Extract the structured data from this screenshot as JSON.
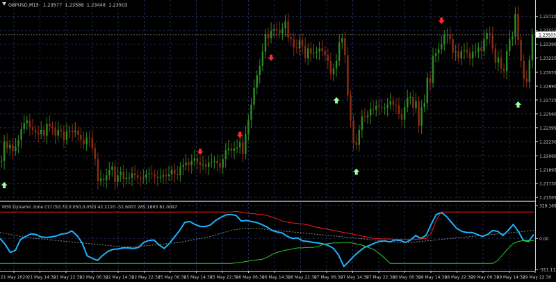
{
  "main_chart": {
    "symbol": "GBPUSD",
    "timeframe": "M15",
    "ohlc": [
      "1.23577",
      "1.23588",
      "1.23448",
      "1.23503"
    ],
    "current_price": "1.23503",
    "price_scale": [
      "1.23720",
      "1.23555",
      "1.23390",
      "1.23225",
      "1.23055",
      "1.22890",
      "1.22725",
      "1.22560",
      "1.22395",
      "1.22230",
      "1.22060",
      "1.21895",
      "1.21730",
      "1.21565"
    ]
  },
  "indicator": {
    "label": "M30 Dynamic zone CCI (50,70,0.050,0.050) 42.2120 -52.6007 265.1863 81.0097",
    "scale": [
      "329.1699",
      "0.00",
      "-311.1133"
    ]
  },
  "time_axis": [
    "21 May 2020",
    "21 May 14:30",
    "21 May 22:30",
    "22 May 06:30",
    "22 May 14:30",
    "22 May 22:30",
    "25 May 06:30",
    "25 May 14:30",
    "25 May 22:30",
    "26 May 06:30",
    "26 May 14:30",
    "26 May 22:30",
    "27 May 06:30",
    "27 May 14:30",
    "27 May 22:30",
    "28 May 06:30",
    "28 May 14:30",
    "28 May 22:30",
    "29 May 06:30",
    "29 May 14:30",
    "29 May 22:30"
  ],
  "colors": {
    "background": "#000000",
    "grid": "#1f2a52",
    "axis": "#c8c8c8",
    "bull_candle": "#2e8b22",
    "bear_candle": "#8b2d12",
    "buy_arrow": "#9fff9f",
    "sell_arrow": "#ff2a2a",
    "cci_line": "#1eb4ff",
    "upper_zone": "#ff1a1a",
    "lower_zone": "#2ecc2e",
    "signal_line": "#8a8a8a"
  },
  "signals": {
    "sell": [
      {
        "x": 70,
        "price": 1.2203
      },
      {
        "x": 84,
        "price": 1.2223
      },
      {
        "x": 95,
        "price": 1.2315
      },
      {
        "x": 155,
        "price": 1.2359
      }
    ],
    "buy": [
      {
        "x": 1,
        "price": 1.2179
      },
      {
        "x": 118,
        "price": 1.228
      },
      {
        "x": 125,
        "price": 1.2195
      },
      {
        "x": 182,
        "price": 1.2275
      }
    ]
  },
  "chart_data": [
    {
      "type": "candlestick",
      "title": "GBPUSD,M15",
      "close": [
        1.22,
        1.2223,
        1.2215,
        1.2219,
        1.2212,
        1.2217,
        1.2225,
        1.2238,
        1.2245,
        1.2248,
        1.224,
        1.2237,
        1.2234,
        1.2232,
        1.2237,
        1.223,
        1.2244,
        1.2241,
        1.2239,
        1.223,
        1.2237,
        1.2235,
        1.2225,
        1.2235,
        1.2236,
        1.2234,
        1.2236,
        1.2231,
        1.2225,
        1.222,
        1.2228,
        1.2227,
        1.2215,
        1.2202,
        1.2176,
        1.2179,
        1.2177,
        1.2183,
        1.2189,
        1.2193,
        1.2175,
        1.2183,
        1.2187,
        1.2178,
        1.218,
        1.218,
        1.2185,
        1.2183,
        1.218,
        1.2179,
        1.218,
        1.2184,
        1.2185,
        1.2184,
        1.2181,
        1.218,
        1.2181,
        1.2183,
        1.2182,
        1.2184,
        1.2189,
        1.2184,
        1.2183,
        1.2193,
        1.2195,
        1.2198,
        1.2195,
        1.22,
        1.2203,
        1.2198,
        1.2195,
        1.2196,
        1.2193,
        1.2198,
        1.2199,
        1.22,
        1.2197,
        1.2192,
        1.2202,
        1.2213,
        1.2215,
        1.2212,
        1.2215,
        1.2216,
        1.2222,
        1.2208,
        1.2232,
        1.2249,
        1.2267,
        1.2287,
        1.2302,
        1.2313,
        1.233,
        1.2351,
        1.2346,
        1.2355,
        1.2357,
        1.2356,
        1.2352,
        1.2358,
        1.2366,
        1.2347,
        1.2345,
        1.2335,
        1.2334,
        1.2344,
        1.2337,
        1.2322,
        1.2334,
        1.2328,
        1.2329,
        1.233,
        1.2334,
        1.2331,
        1.2326,
        1.2319,
        1.2303,
        1.231,
        1.2319,
        1.2341,
        1.2346,
        1.2326,
        1.2278,
        1.2248,
        1.2222,
        1.2219,
        1.2237,
        1.2253,
        1.2252,
        1.2254,
        1.2262,
        1.2261,
        1.2266,
        1.2264,
        1.2263,
        1.2263,
        1.2267,
        1.2271,
        1.2267,
        1.2266,
        1.2256,
        1.2249,
        1.2264,
        1.2275,
        1.2276,
        1.2263,
        1.2271,
        1.2242,
        1.2264,
        1.2269,
        1.2299,
        1.2293,
        1.2325,
        1.2328,
        1.2333,
        1.2339,
        1.235,
        1.235,
        1.2345,
        1.2329,
        1.233,
        1.2322,
        1.2331,
        1.2332,
        1.2329,
        1.2322,
        1.233,
        1.233,
        1.2335,
        1.2331,
        1.2345,
        1.2352,
        1.235,
        1.2334,
        1.2317,
        1.2323,
        1.231,
        1.2307,
        1.2331,
        1.2345,
        1.2348,
        1.2375,
        1.2344,
        1.2319,
        1.2298,
        1.2294,
        1.232,
        1.235
      ],
      "ylim": [
        1.2155,
        1.238
      ]
    },
    {
      "type": "line",
      "title": "M30 Dynamic zone CCI (50,70,0.050,0.050)",
      "ylim": [
        -311.1133,
        329.1699
      ],
      "series": [
        {
          "values": [
            0,
            -60,
            -140,
            -120,
            -10,
            20,
            45,
            40,
            15,
            10,
            15,
            25,
            45,
            50,
            75,
            30,
            -45,
            -175,
            -200,
            -220,
            -170,
            -130,
            -110,
            -105,
            -95,
            -95,
            -100,
            -90,
            -40,
            -20,
            -15,
            -65,
            -100,
            -50,
            15,
            80,
            160,
            170,
            140,
            120,
            120,
            135,
            180,
            210,
            235,
            240,
            230,
            175,
            180,
            170,
            160,
            140,
            115,
            80,
            65,
            55,
            20,
            0,
            5,
            -25,
            -30,
            -40,
            -45,
            -55,
            -70,
            -100,
            -170,
            -280,
            -230,
            -175,
            -130,
            -90,
            -70,
            -45,
            -30,
            -25,
            -35,
            -15,
            -20,
            -40,
            -15,
            30,
            0,
            30,
            140,
            240,
            260,
            220,
            160,
            100,
            70,
            60,
            60,
            40,
            20,
            40,
            80,
            70,
            30,
            80,
            140,
            70,
            -20,
            -30,
            40
          ]
        },
        {
          "values": [
            265,
            265,
            265,
            265,
            265,
            265,
            265,
            265,
            265,
            265,
            265,
            265,
            265,
            265,
            265,
            265,
            265,
            265,
            265,
            265,
            265,
            265,
            265,
            265,
            265,
            265,
            265,
            265,
            265,
            265,
            265,
            265,
            265,
            265,
            265,
            265,
            265,
            265,
            265,
            265,
            265,
            265,
            265,
            265,
            265,
            265,
            270,
            265,
            255,
            250,
            245,
            240,
            230,
            215,
            195,
            175,
            165,
            155,
            150,
            145,
            135,
            120,
            110,
            100,
            90,
            80,
            70,
            60,
            50,
            40,
            30,
            20,
            10,
            0,
            -5,
            -5,
            -5,
            -10,
            -10,
            -10,
            -10,
            -10,
            -5,
            0,
            50,
            180,
            265,
            265,
            265,
            265,
            265,
            265,
            265,
            265,
            265,
            265,
            265,
            265,
            265,
            265,
            265,
            265,
            265,
            265,
            265
          ]
        },
        {
          "values": [
            -250,
            -250,
            -250,
            -250,
            -250,
            -250,
            -250,
            -250,
            -250,
            -250,
            -250,
            -250,
            -250,
            -250,
            -250,
            -250,
            -250,
            -250,
            -250,
            -250,
            -250,
            -250,
            -250,
            -250,
            -250,
            -250,
            -250,
            -250,
            -250,
            -250,
            -250,
            -250,
            -250,
            -250,
            -250,
            -250,
            -250,
            -250,
            -250,
            -250,
            -250,
            -250,
            -250,
            -250,
            -250,
            -250,
            -245,
            -240,
            -230,
            -220,
            -215,
            -210,
            -190,
            -160,
            -140,
            -125,
            -115,
            -105,
            -95,
            -95,
            -90,
            -90,
            -80,
            -60,
            -50,
            -45,
            -45,
            -40,
            -40,
            -50,
            -60,
            -75,
            -95,
            -115,
            -155,
            -200,
            -250,
            -250,
            -250,
            -250,
            -250,
            -250,
            -250,
            -250,
            -250,
            -250,
            -250,
            -250,
            -250,
            -250,
            -250,
            -250,
            -250,
            -250,
            -250,
            -250,
            -250,
            -220,
            -160,
            -100,
            -50,
            -30,
            -20,
            -20,
            -20
          ]
        },
        {
          "values": [
            60,
            50,
            40,
            30,
            20,
            10,
            5,
            0,
            -5,
            -10,
            -15,
            -20,
            -25,
            -30,
            -35,
            -40,
            -45,
            -50,
            -55,
            -60,
            -65,
            -70,
            -75,
            -80,
            -85,
            -85,
            -85,
            -80,
            -75,
            -70,
            -65,
            -60,
            -55,
            -50,
            -45,
            -40,
            -30,
            -20,
            -10,
            0,
            10,
            20,
            35,
            50,
            65,
            80,
            90,
            95,
            100,
            100,
            100,
            95,
            90,
            85,
            80,
            75,
            70,
            65,
            60,
            55,
            50,
            45,
            40,
            35,
            30,
            25,
            20,
            15,
            10,
            5,
            0,
            -5,
            -10,
            -15,
            -20,
            -25,
            -30,
            -35,
            -40,
            -40,
            -40,
            -35,
            -30,
            -25,
            -20,
            -15,
            -10,
            -5,
            0,
            5,
            10,
            15,
            20,
            25,
            30,
            35,
            40,
            45,
            50,
            55,
            60,
            65,
            70,
            75,
            80
          ]
        }
      ]
    }
  ]
}
